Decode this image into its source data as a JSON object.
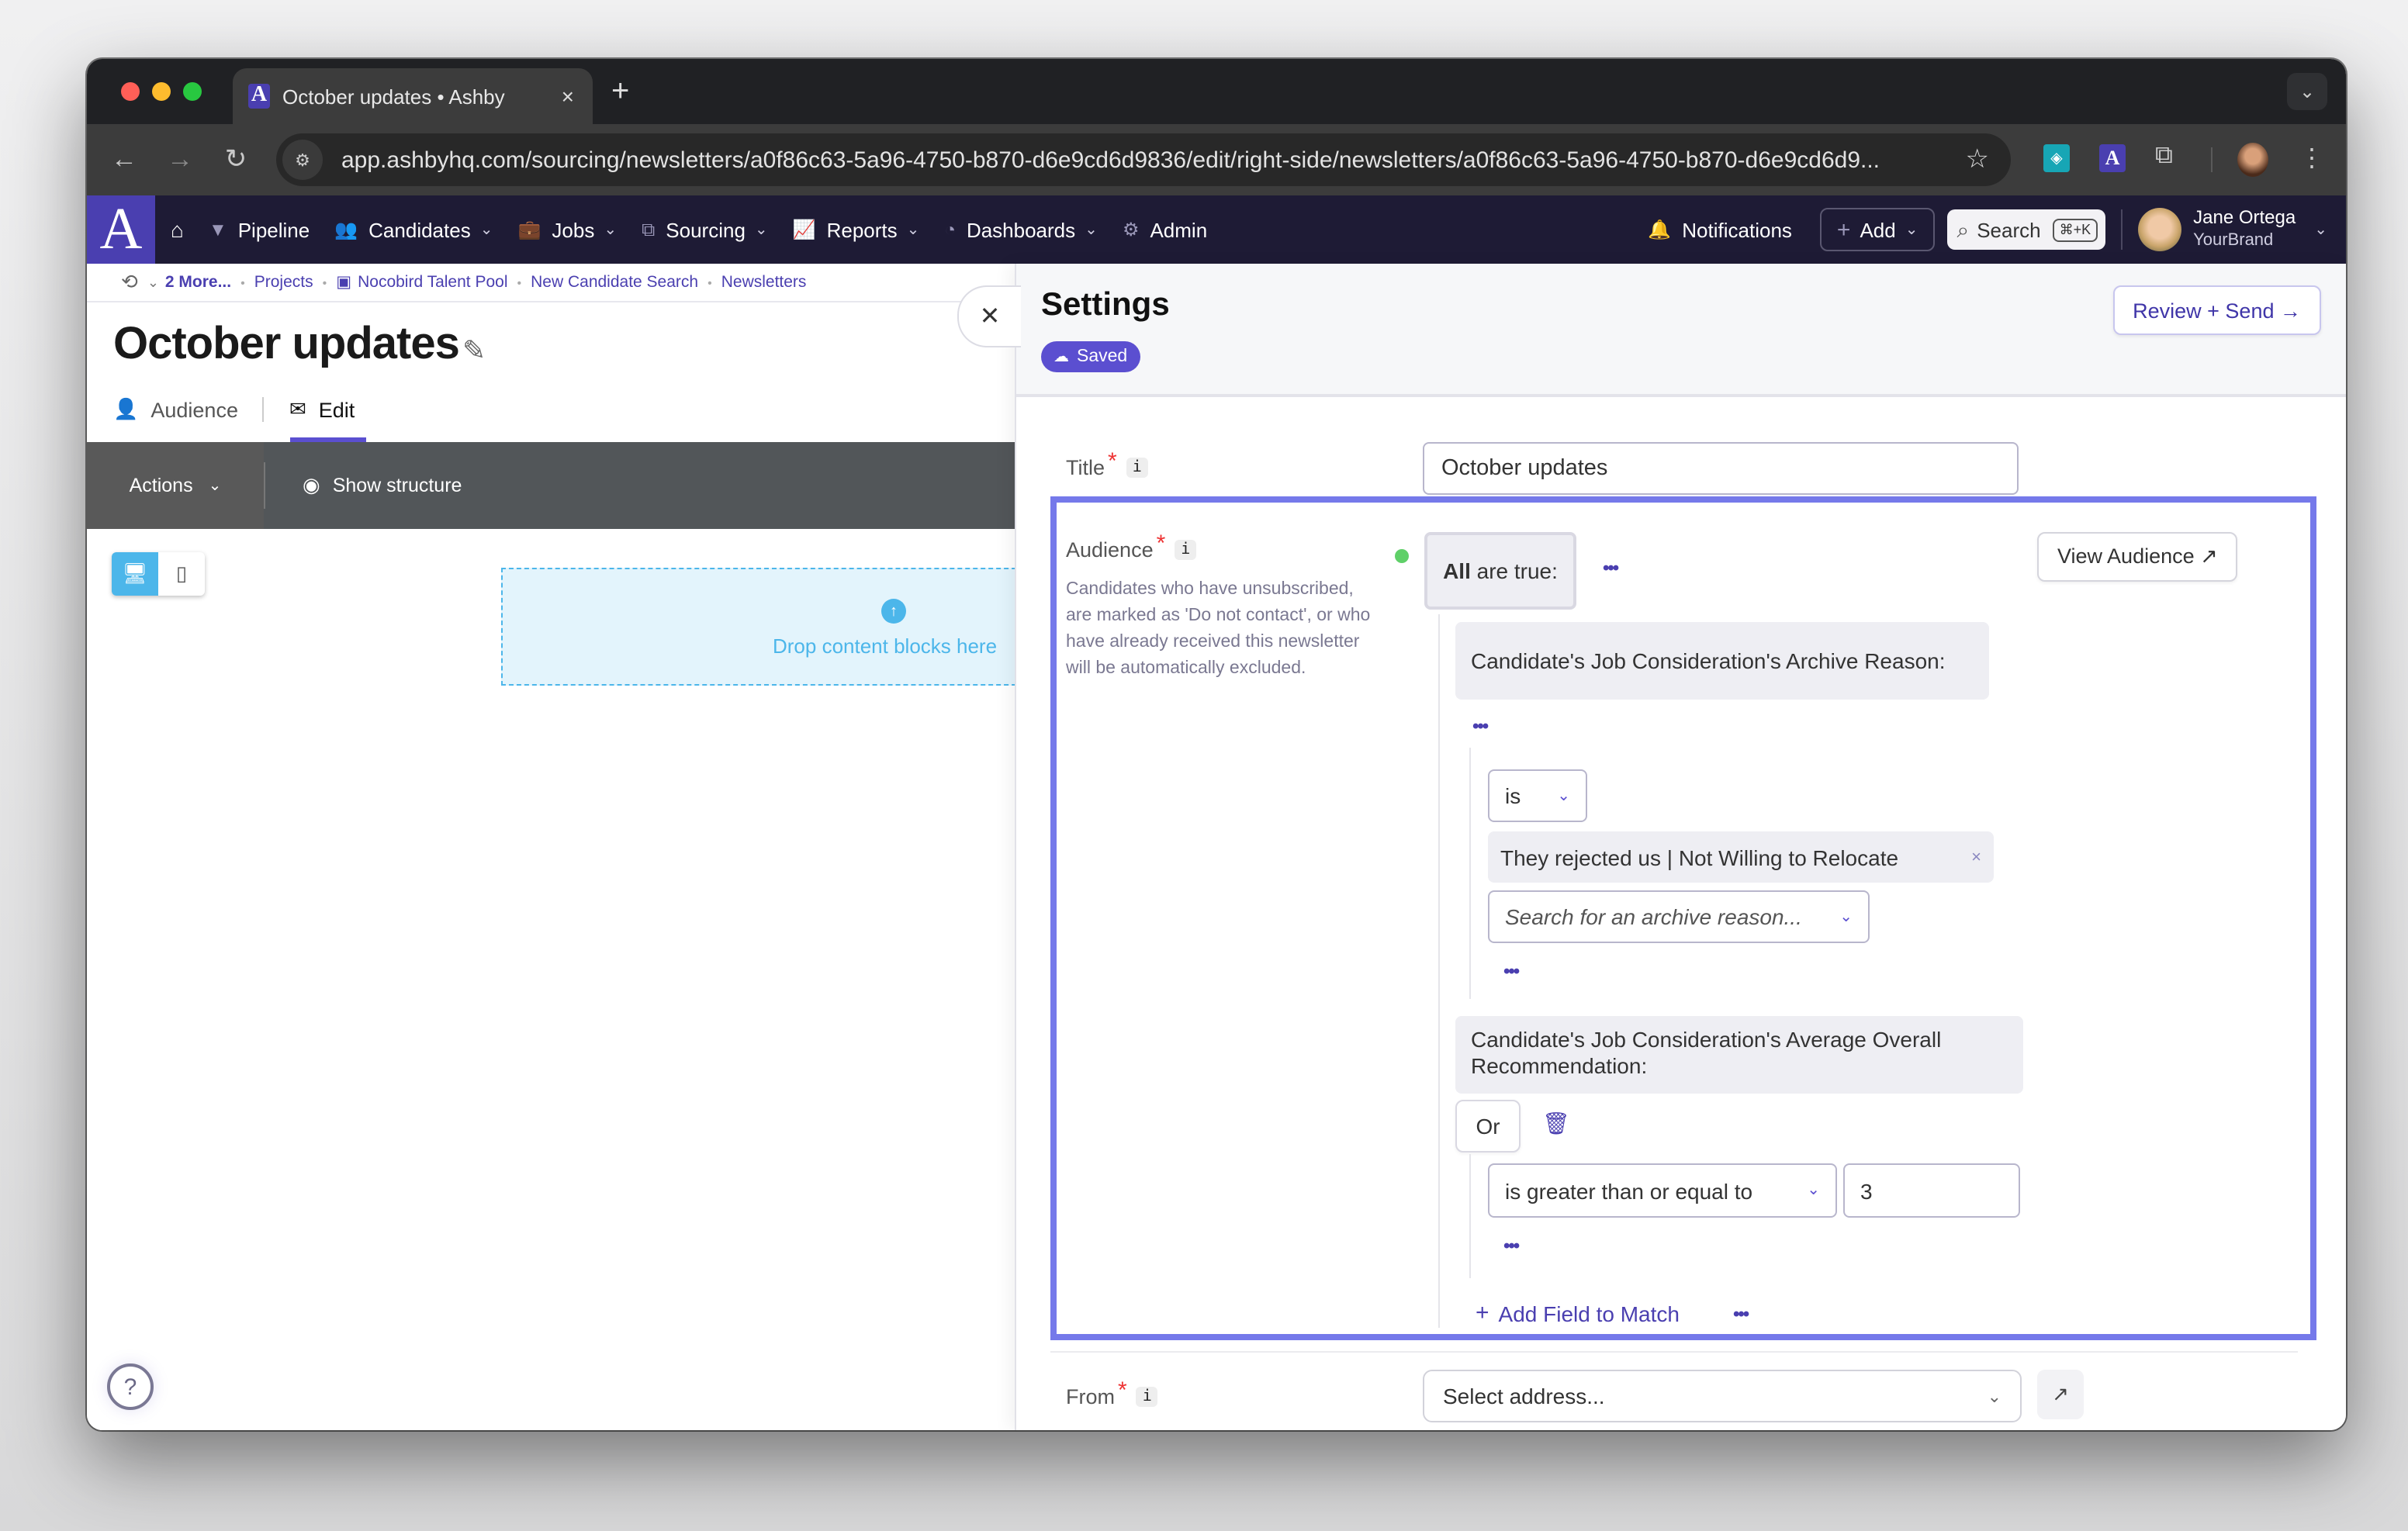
{
  "browser": {
    "tab_title": "October updates • Ashby",
    "tab_favicon": "A",
    "tab_close": "×",
    "new_tab": "+",
    "url": "app.ashbyhq.com/sourcing/newsletters/a0f86c63-5a96-4750-b870-d6e9cd6d9836/edit/right-side/newsletters/a0f86c63-5a96-4750-b870-d6e9cd6d9...",
    "icons": {
      "back": "←",
      "forward": "→",
      "reload": "↻",
      "site_info": "⚙",
      "bookmark": "☆",
      "extension_1": "◈",
      "extension_2": "A",
      "extensions": "⧉",
      "menu": "⋮",
      "tab_menu": "⌄"
    },
    "traffic_colors": [
      "#ff5f57",
      "#febc2e",
      "#28c840"
    ]
  },
  "app_nav": {
    "logo": "A",
    "home_icon": "⌂",
    "items": [
      {
        "label": "Pipeline",
        "icon": "▼",
        "has_dropdown": false
      },
      {
        "label": "Candidates",
        "icon": "👥",
        "has_dropdown": true
      },
      {
        "label": "Jobs",
        "icon": "💼",
        "has_dropdown": true
      },
      {
        "label": "Sourcing",
        "icon": "⧉",
        "has_dropdown": true
      },
      {
        "label": "Reports",
        "icon": "📈",
        "has_dropdown": true
      },
      {
        "label": "Dashboards",
        "icon": "◔",
        "has_dropdown": true
      },
      {
        "label": "Admin",
        "icon": "⚙",
        "has_dropdown": false
      }
    ],
    "chevron": "⌄",
    "notifications_label": "Notifications",
    "notifications_icon": "🔔",
    "add_label": "Add",
    "add_icon": "+",
    "search_label": "Search",
    "search_icon": "⌕",
    "search_shortcut": "⌘+K",
    "user_name": "Jane Ortega",
    "user_org": "YourBrand"
  },
  "breadcrumb": {
    "history_icon": "⟲",
    "items": [
      "2 More...",
      "Projects",
      "Nocobird Talent Pool",
      "New Candidate Search",
      "Newsletters"
    ],
    "separator": "•",
    "talent_pool_icon": "▣"
  },
  "page": {
    "title": "October updates",
    "edit_icon": "✎",
    "tabs": [
      {
        "label": "Audience",
        "icon": "👤",
        "active": false
      },
      {
        "label": "Edit",
        "icon": "✉",
        "active": true
      }
    ],
    "editor_toolbar": {
      "actions_label": "Actions",
      "show_structure_label": "Show structure",
      "eye_icon": "◉"
    },
    "device_toggle": {
      "desktop_icon": "🖥",
      "mobile_icon": "▯",
      "selected": "desktop"
    },
    "dropzone": {
      "icon": "↑",
      "text": "Drop content blocks here"
    },
    "help_icon": "?"
  },
  "panel": {
    "close_icon": "✕",
    "title": "Settings",
    "saved_badge": "Saved",
    "saved_icon": "☁",
    "review_send_label": "Review + Send →",
    "title_field": {
      "label": "Title",
      "required": "*",
      "info": "i",
      "value": "October updates"
    },
    "audience": {
      "label": "Audience",
      "required": "*",
      "info": "i",
      "description": "Candidates who have unsubscribed, are marked as 'Do not contact', or who have already received this newsletter will be automatically excluded.",
      "status_color": "#5fd068",
      "group_label_bold": "All",
      "group_label_rest": " are true:",
      "more": "•••",
      "view_audience_label": "View Audience ↗",
      "conditions": [
        {
          "field": "Candidate's Job Consideration's Archive Reason:",
          "operator": "is",
          "selected_values": [
            "They rejected us | Not Willing to Relocate"
          ],
          "chip_remove": "×",
          "search_placeholder": "Search for an archive reason..."
        },
        {
          "field": "Candidate's Job Consideration's Average Overall Recommendation:",
          "logic": "Or",
          "trash_icon": "🗑",
          "operator": "is greater than or equal to",
          "value": "3"
        }
      ],
      "add_field_label": "Add Field to Match",
      "add_icon": "+"
    },
    "from_field": {
      "label": "From",
      "required": "*",
      "info": "i",
      "placeholder": "Select address...",
      "external_icon": "↗"
    }
  },
  "colors": {
    "accent": "#5b4fd0",
    "nav_bg": "#1e1b35",
    "highlight_border": "#7579ea",
    "dropzone": "#4cb6ea"
  }
}
